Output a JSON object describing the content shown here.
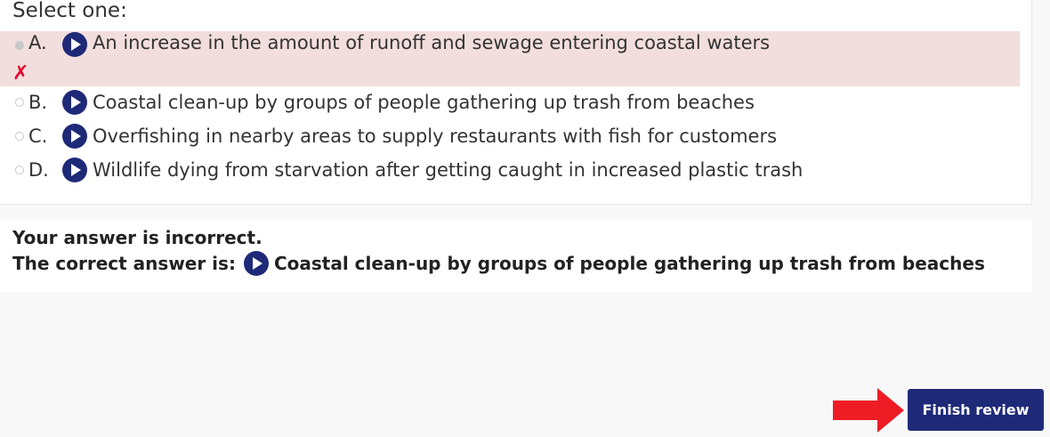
{
  "question": {
    "prompt": "Select one:",
    "options": [
      {
        "letter": "A.",
        "text": "An increase in the amount of runoff and sewage entering coastal waters",
        "selected": true,
        "status": "incorrect"
      },
      {
        "letter": "B.",
        "text": "Coastal clean-up by groups of people gathering up trash from beaches",
        "selected": false
      },
      {
        "letter": "C.",
        "text": "Overfishing in nearby areas to supply restaurants with fish for customers",
        "selected": false
      },
      {
        "letter": "D.",
        "text": "Wildlife dying from starvation after getting caught in increased plastic trash",
        "selected": false
      }
    ],
    "wrong_mark": "✗"
  },
  "feedback": {
    "status": "Your answer is incorrect.",
    "correct_prefix": "The correct answer is:",
    "correct_answer": "Coastal clean-up by groups of people gathering up trash from beaches"
  },
  "actions": {
    "finish_label": "Finish review"
  },
  "colors": {
    "accent": "#1e2a78",
    "incorrect_bg": "#f2dedd",
    "incorrect_mark": "#e4002b",
    "arrow": "#ee1c25"
  },
  "icons": [
    "play-icon",
    "cross-icon",
    "arrow-right-icon"
  ]
}
